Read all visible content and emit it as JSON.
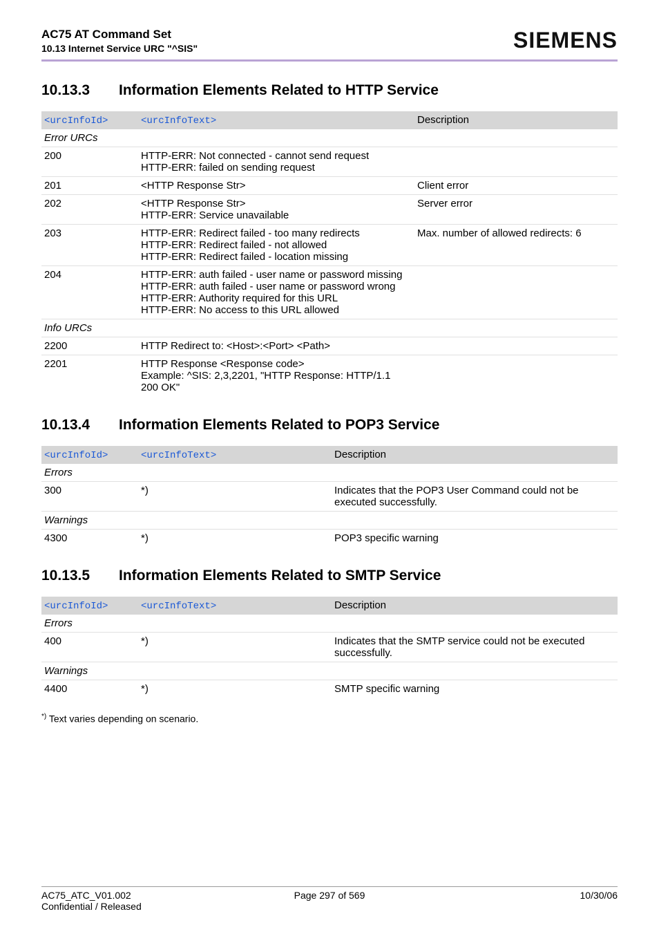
{
  "header": {
    "title": "AC75 AT Command Set",
    "subtitle": "10.13 Internet Service URC \"^SIS\"",
    "brand": "SIEMENS"
  },
  "sections": [
    {
      "num": "10.13.3",
      "title": "Information Elements Related to HTTP Service",
      "table": {
        "layout": "a",
        "headers": {
          "id": "<urcInfoId>",
          "text": "<urcInfoText>",
          "desc": "Description"
        },
        "groups": [
          {
            "label": "Error URCs",
            "rows": [
              {
                "id": "200",
                "text": "HTTP-ERR: Not connected - cannot send request\nHTTP-ERR: failed on sending request",
                "desc": ""
              },
              {
                "id": "201",
                "text": "<HTTP Response Str>",
                "desc": "Client error"
              },
              {
                "id": "202",
                "text": "<HTTP Response Str>\nHTTP-ERR: Service unavailable",
                "desc": "Server error"
              },
              {
                "id": "203",
                "text": "HTTP-ERR: Redirect failed - too many redirects\nHTTP-ERR: Redirect failed - not allowed\nHTTP-ERR: Redirect failed - location missing",
                "desc": "Max. number of allowed redirects: 6"
              },
              {
                "id": "204",
                "text": "HTTP-ERR: auth failed - user name or password missing\nHTTP-ERR: auth failed - user name or password wrong\nHTTP-ERR: Authority required for this URL\nHTTP-ERR: No access to this URL allowed",
                "desc": ""
              }
            ]
          },
          {
            "label": "Info URCs",
            "rows": [
              {
                "id": "2200",
                "text": "HTTP Redirect to: <Host>:<Port> <Path>",
                "desc": ""
              },
              {
                "id": "2201",
                "text": "HTTP Response <Response code>\nExample: ^SIS: 2,3,2201, \"HTTP Response: HTTP/1.1 200 OK\"",
                "desc": ""
              }
            ]
          }
        ]
      }
    },
    {
      "num": "10.13.4",
      "title": "Information Elements Related to POP3 Service",
      "table": {
        "layout": "b",
        "headers": {
          "id": "<urcInfoId>",
          "text": "<urcInfoText>",
          "desc": "Description"
        },
        "groups": [
          {
            "label": "Errors",
            "rows": [
              {
                "id": "300",
                "text": "*)",
                "desc": "Indicates that the POP3 User Command could not be executed successfully."
              }
            ]
          },
          {
            "label": "Warnings",
            "rows": [
              {
                "id": "4300",
                "text": "*)",
                "desc": "POP3 specific warning"
              }
            ]
          }
        ]
      }
    },
    {
      "num": "10.13.5",
      "title": "Information Elements Related to SMTP Service",
      "table": {
        "layout": "b",
        "headers": {
          "id": "<urcInfoId>",
          "text": "<urcInfoText>",
          "desc": "Description"
        },
        "groups": [
          {
            "label": "Errors",
            "rows": [
              {
                "id": "400",
                "text": "*)",
                "desc": "Indicates that the SMTP service could not be executed successfully."
              }
            ]
          },
          {
            "label": "Warnings",
            "rows": [
              {
                "id": "4400",
                "text": "*)",
                "desc": "SMTP specific warning"
              }
            ]
          }
        ]
      }
    }
  ],
  "footnote": {
    "marker": "*)",
    "text": " Text varies depending on scenario."
  },
  "footer": {
    "left1": "AC75_ATC_V01.002",
    "center1": "Page 297 of 569",
    "right1": "10/30/06",
    "left2": "Confidential / Released"
  }
}
